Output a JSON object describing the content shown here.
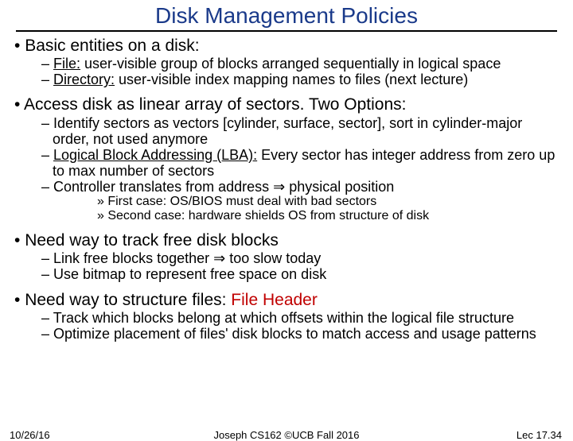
{
  "title": "Disk Management Policies",
  "bullets": [
    {
      "text": "Basic entities on a disk:",
      "dashes": [
        {
          "lead": "File:",
          "lead_underline": true,
          "rest": " user-visible group of blocks arranged sequentially in logical space"
        },
        {
          "lead": "Directory:",
          "lead_underline": true,
          "rest": " user-visible index mapping names to files (next lecture)"
        }
      ]
    },
    {
      "text": "Access disk as linear array of sectors.  Two Options:",
      "dashes": [
        {
          "lead": "",
          "rest": "Identify sectors as vectors [cylinder, surface, sector], sort in cylinder-major order, not used anymore"
        },
        {
          "lead": "Logical Block Addressing (LBA):",
          "lead_underline": true,
          "rest": " Every sector has integer address from zero up to max number of sectors"
        },
        {
          "lead": "",
          "rest": "Controller translates from address ⇒ physical position",
          "chev": [
            "First case: OS/BIOS must deal with bad sectors",
            "Second case: hardware shields OS from structure of disk"
          ]
        }
      ]
    },
    {
      "text": "Need way to track free disk blocks",
      "dashes": [
        {
          "lead": "",
          "rest": "Link free blocks together ⇒ too slow today"
        },
        {
          "lead": "",
          "rest": "Use bitmap to represent free space on disk"
        }
      ]
    },
    {
      "text": "Need way to structure files: ",
      "text_red": "File Header",
      "dashes": [
        {
          "lead": "",
          "rest": "Track which blocks belong at which offsets within the logical file structure"
        },
        {
          "lead": "",
          "rest": "Optimize placement of files' disk blocks to match access and usage patterns"
        }
      ]
    }
  ],
  "footer": {
    "date": "10/26/16",
    "center": "Joseph CS162 ©UCB Fall 2016",
    "right": "Lec 17.34"
  }
}
